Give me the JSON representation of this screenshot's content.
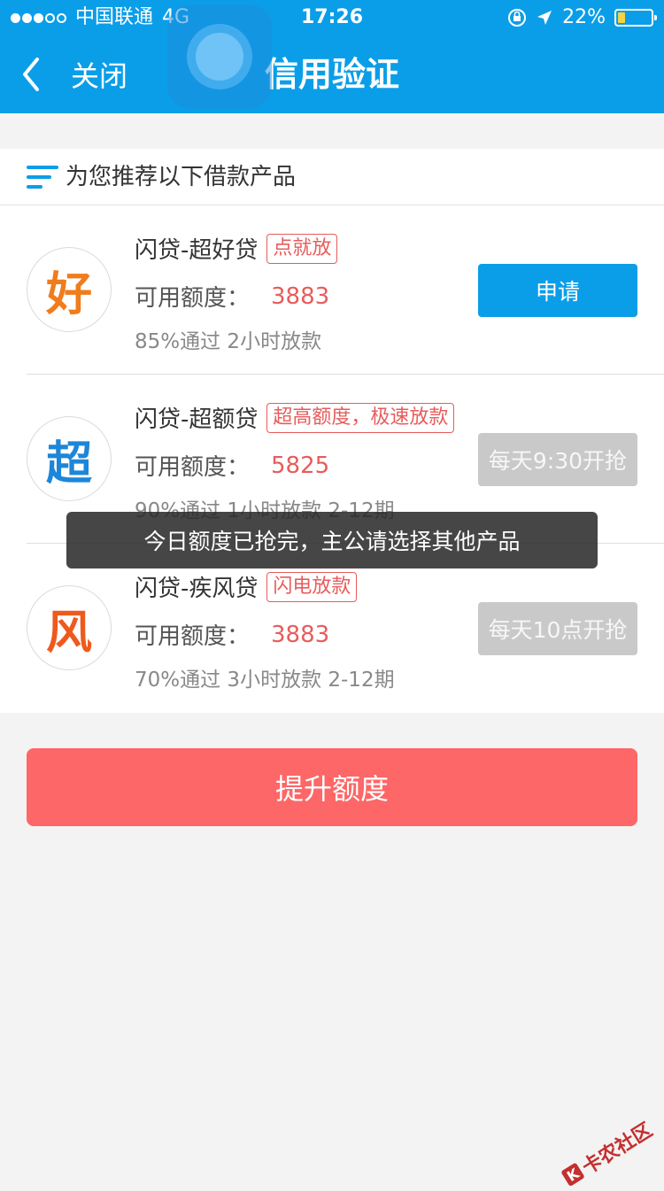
{
  "status_bar": {
    "carrier": "中国联通",
    "network": "4G",
    "time": "17:26",
    "battery": "22%",
    "battery_level": 0.22
  },
  "nav": {
    "close_label": "关闭",
    "title": "信用验证"
  },
  "section": {
    "title": "为您推荐以下借款产品"
  },
  "products": [
    {
      "logo": "好",
      "logo_color": "#f07c1c",
      "name": "闪贷-超好贷",
      "tag": "点就放",
      "credit_label": "可用额度：",
      "credit_value": "3883",
      "meta": "85%通过 2小时放款",
      "action": "申请",
      "action_enabled": true
    },
    {
      "logo": "超",
      "logo_color": "#1e86d8",
      "name": "闪贷-超额贷",
      "tag": "超高额度，极速放款",
      "credit_label": "可用额度：",
      "credit_value": "5825",
      "meta": "90%通过 1小时放款    2-12期",
      "action": "每天9:30开抢",
      "action_enabled": false
    },
    {
      "logo": "风",
      "logo_color": "#ee5a1e",
      "name": "闪贷-疾风贷",
      "tag": "闪电放款",
      "credit_label": "可用额度：",
      "credit_value": "3883",
      "meta": "70%通过 3小时放款    2-12期",
      "action": "每天10点开抢",
      "action_enabled": false
    }
  ],
  "boost_button": "提升额度",
  "toast": "今日额度已抢完，主公请选择其他产品",
  "watermark": {
    "mark": "K",
    "text": "卡农社区"
  },
  "colors": {
    "primary": "#0b9ee8",
    "accent_red": "#fd6767",
    "tag_red": "#e85c5c",
    "disabled": "#c9c9c9"
  }
}
